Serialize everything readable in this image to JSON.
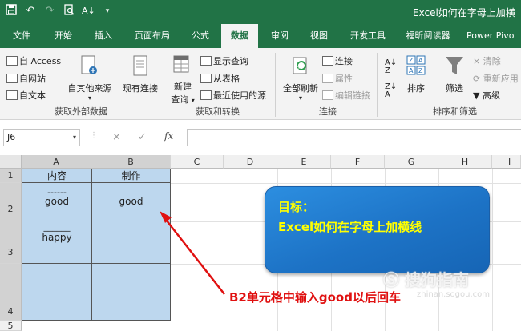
{
  "window": {
    "title": "Excel如何在字母上加横"
  },
  "qat": {
    "save": "save-icon",
    "undo": "undo-icon",
    "redo": "redo-icon",
    "preview": "print-preview-icon",
    "sort": "sort-icon",
    "more": "customize-icon"
  },
  "tabs": [
    {
      "label": "文件"
    },
    {
      "label": "开始"
    },
    {
      "label": "插入"
    },
    {
      "label": "页面布局"
    },
    {
      "label": "公式"
    },
    {
      "label": "数据"
    },
    {
      "label": "审阅"
    },
    {
      "label": "视图"
    },
    {
      "label": "开发工具"
    },
    {
      "label": "福昕阅读器"
    },
    {
      "label": "Power Pivo"
    }
  ],
  "ribbon": {
    "get_external": {
      "access": "自 Access",
      "web": "自网站",
      "text": "自文本",
      "other": "自其他来源",
      "existing": "现有连接",
      "group": "获取外部数据"
    },
    "transform": {
      "new_query_1": "新建",
      "new_query_2": "查询",
      "show_queries": "显示查询",
      "from_table": "从表格",
      "recent": "最近使用的源",
      "group": "获取和转换"
    },
    "connections": {
      "refresh_all": "全部刷新",
      "connections": "连接",
      "properties": "属性",
      "edit_links": "编辑链接",
      "group": "连接"
    },
    "sort_filter": {
      "sort": "排序",
      "filter": "筛选",
      "clear": "清除",
      "reapply": "重新应用",
      "advanced": "高级",
      "group": "排序和筛选"
    }
  },
  "formula_bar": {
    "name_box": "J6",
    "cancel": "×",
    "enter": "✓",
    "fx": "fx",
    "value": ""
  },
  "columns": [
    "A",
    "B",
    "C",
    "D",
    "E",
    "F",
    "G",
    "H",
    "I"
  ],
  "rows": [
    "1",
    "2",
    "3",
    "4",
    "5"
  ],
  "cells": {
    "A1": "内容",
    "B1": "制作",
    "A2_over": "------",
    "A2": "good",
    "B2": "good",
    "A3_over": "______",
    "A3": "happy"
  },
  "callout": {
    "line1": "目标：",
    "line2": "Excel如何在字母上加横线"
  },
  "annotation": "B2单元格中输入good以后回车",
  "watermark": {
    "text": "搜狗指南",
    "url": "zhinan.sogou.com"
  },
  "colors": {
    "excel_green": "#217346",
    "selection_fill": "#bdd7ee",
    "callout_blue": "#1d73c6",
    "callout_text": "#ffff00",
    "annotation_red": "#e01010"
  }
}
